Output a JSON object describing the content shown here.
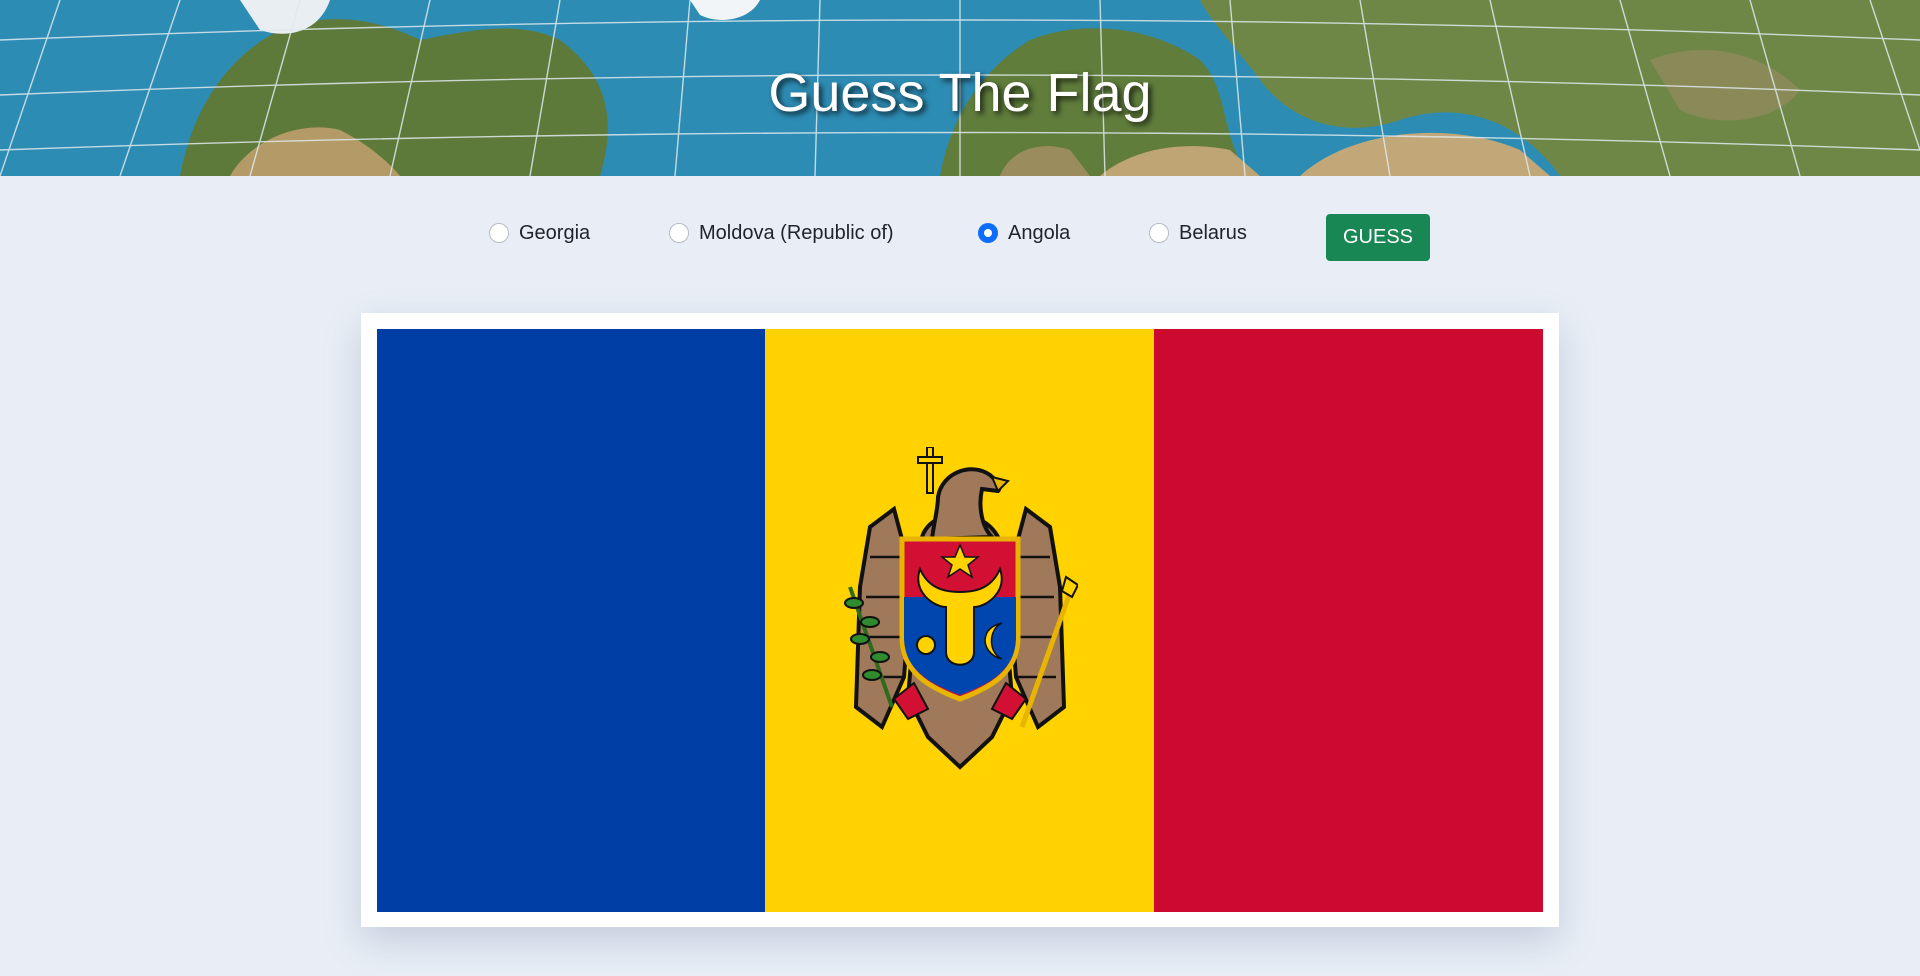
{
  "header": {
    "title": "Guess The Flag"
  },
  "quiz": {
    "options": [
      {
        "label": "Georgia",
        "selected": false
      },
      {
        "label": "Moldova (Republic of)",
        "selected": false
      },
      {
        "label": "Angola",
        "selected": true
      },
      {
        "label": "Belarus",
        "selected": false
      }
    ],
    "guess_label": "GUESS"
  },
  "flag": {
    "colors": [
      "#003da5",
      "#ffd200",
      "#cc092f"
    ]
  },
  "colors": {
    "accent_radio": "#0d6efd",
    "guess_button": "#198754",
    "page_background": "#e9eef6"
  }
}
